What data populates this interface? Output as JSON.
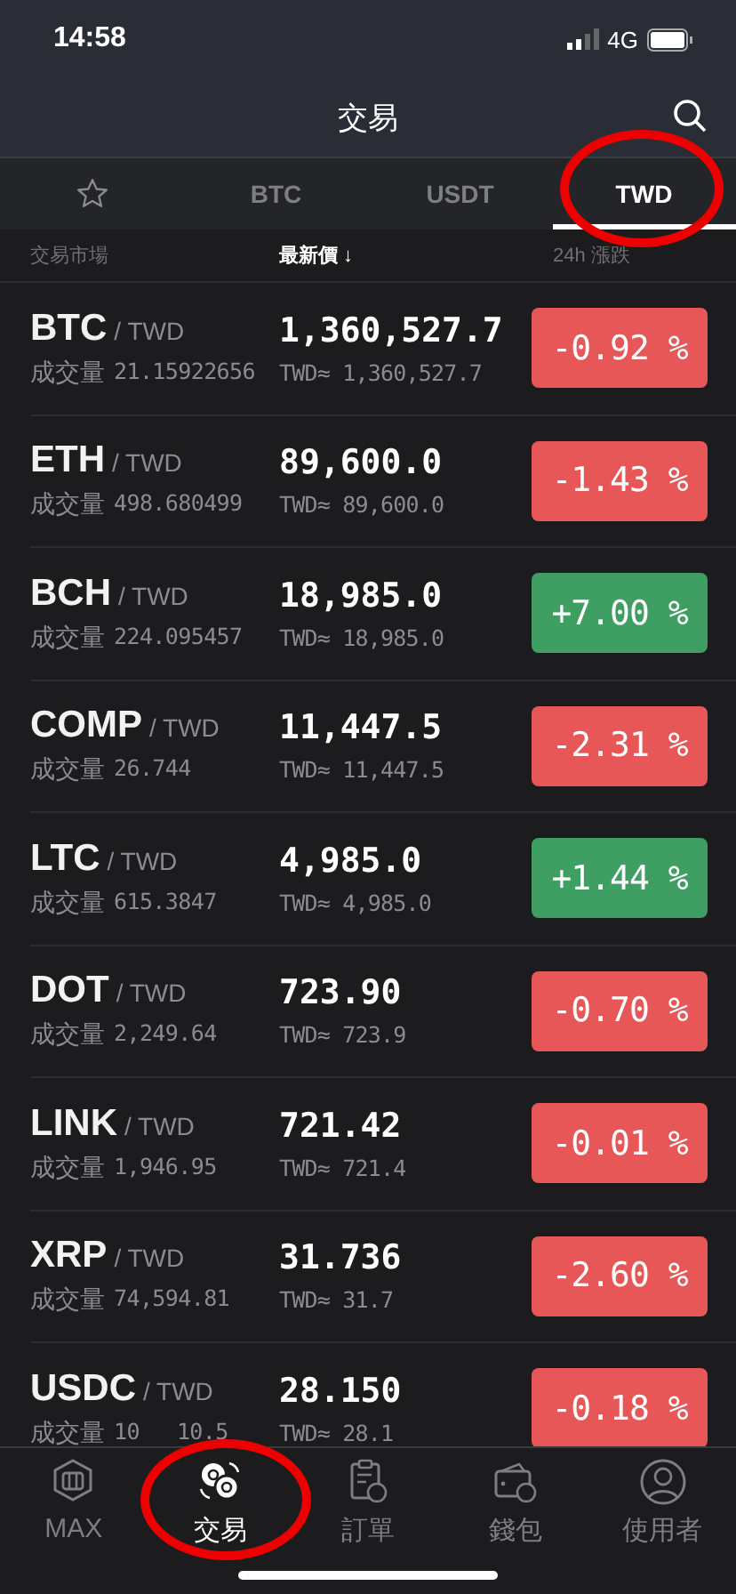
{
  "status_bar": {
    "time": "14:58",
    "network": "4G"
  },
  "header": {
    "title": "交易"
  },
  "tabs": [
    {
      "kind": "star",
      "selected": false,
      "circled": false
    },
    {
      "label": "BTC",
      "selected": false,
      "circled": false
    },
    {
      "label": "USDT",
      "selected": false,
      "circled": false
    },
    {
      "label": "TWD",
      "selected": true,
      "circled": true
    }
  ],
  "columns": [
    {
      "label": "交易市場",
      "sorted": false
    },
    {
      "label": "最新價",
      "sorted": true,
      "sort_icon": "↓"
    },
    {
      "label": "24h 漲跌",
      "sorted": false
    }
  ],
  "rows": [
    {
      "base": "BTC",
      "quote": "/ TWD",
      "volume_label": "成交量",
      "volume": "21.15922656",
      "price": "1,360,527.7",
      "fiat": "TWD≈ 1,360,527.7",
      "change": "-0.92 %",
      "color": "#e85757"
    },
    {
      "base": "ETH",
      "quote": "/ TWD",
      "volume_label": "成交量",
      "volume": "498.680499",
      "price": "89,600.0",
      "fiat": "TWD≈ 89,600.0",
      "change": "-1.43 %",
      "color": "#e85757"
    },
    {
      "base": "BCH",
      "quote": "/ TWD",
      "volume_label": "成交量",
      "volume": "224.095457",
      "price": "18,985.0",
      "fiat": "TWD≈ 18,985.0",
      "change": "+7.00 %",
      "color": "#3f9e62"
    },
    {
      "base": "COMP",
      "quote": "/ TWD",
      "volume_label": "成交量",
      "volume": "26.744",
      "price": "11,447.5",
      "fiat": "TWD≈ 11,447.5",
      "change": "-2.31 %",
      "color": "#e85757"
    },
    {
      "base": "LTC",
      "quote": "/ TWD",
      "volume_label": "成交量",
      "volume": "615.3847",
      "price": "4,985.0",
      "fiat": "TWD≈ 4,985.0",
      "change": "+1.44 %",
      "color": "#3f9e62"
    },
    {
      "base": "DOT",
      "quote": "/ TWD",
      "volume_label": "成交量",
      "volume": "2,249.64",
      "price": "723.90",
      "fiat": "TWD≈ 723.9",
      "change": "-0.70 %",
      "color": "#e85757"
    },
    {
      "base": "LINK",
      "quote": "/ TWD",
      "volume_label": "成交量",
      "volume": "1,946.95",
      "price": "721.42",
      "fiat": "TWD≈ 721.4",
      "change": "-0.01 %",
      "color": "#e85757"
    },
    {
      "base": "XRP",
      "quote": "/ TWD",
      "volume_label": "成交量",
      "volume": "74,594.81",
      "price": "31.736",
      "fiat": "TWD≈ 31.7",
      "change": "-2.60 %",
      "color": "#e85757"
    },
    {
      "base": "USDC",
      "quote": "/ TWD",
      "volume_label": "成交量",
      "volume": "10",
      "volume_after": "10.5",
      "price": "28.150",
      "fiat": "TWD≈ 28.1",
      "change": "-0.18 %",
      "color": "#e85757"
    }
  ],
  "nav": [
    {
      "kind": "max",
      "label": "MAX",
      "selected": false,
      "circled": false
    },
    {
      "kind": "trade",
      "label": "交易",
      "selected": true,
      "circled": true
    },
    {
      "kind": "orders",
      "label": "訂單",
      "selected": false,
      "circled": false
    },
    {
      "kind": "wallet",
      "label": "錢包",
      "selected": false,
      "circled": false
    },
    {
      "kind": "user",
      "label": "使用者",
      "selected": false,
      "circled": false
    }
  ]
}
